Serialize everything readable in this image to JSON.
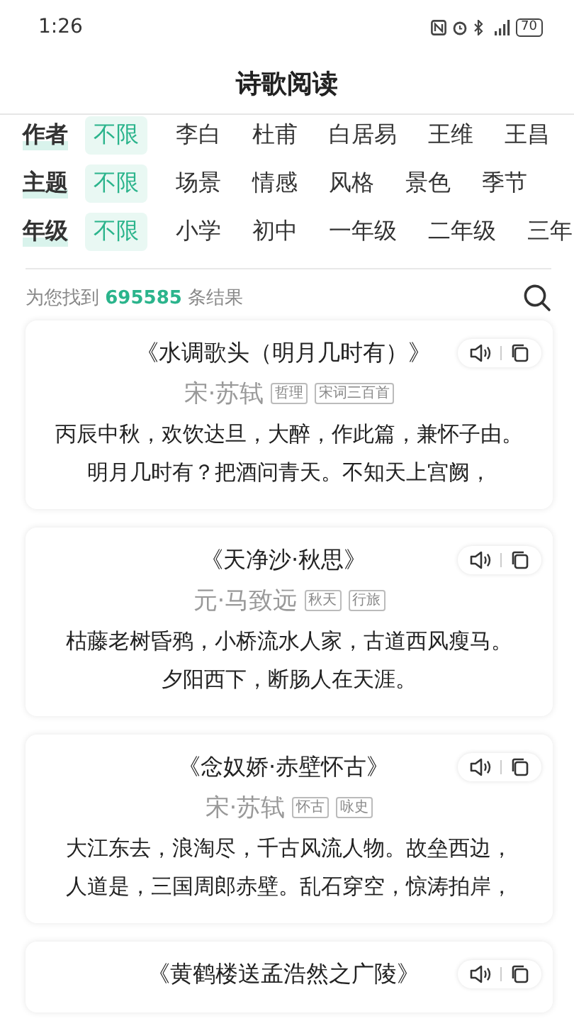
{
  "status_bar": {
    "time": "1:26",
    "battery": "70"
  },
  "header": {
    "title": "诗歌阅读"
  },
  "filters": [
    {
      "label": "作者",
      "options": [
        {
          "text": "不限",
          "selected": true
        },
        {
          "text": "李白",
          "selected": false
        },
        {
          "text": "杜甫",
          "selected": false
        },
        {
          "text": "白居易",
          "selected": false
        },
        {
          "text": "王维",
          "selected": false
        },
        {
          "text": "王昌",
          "selected": false
        }
      ]
    },
    {
      "label": "主题",
      "options": [
        {
          "text": "不限",
          "selected": true
        },
        {
          "text": "场景",
          "selected": false
        },
        {
          "text": "情感",
          "selected": false
        },
        {
          "text": "风格",
          "selected": false
        },
        {
          "text": "景色",
          "selected": false
        },
        {
          "text": "季节",
          "selected": false
        }
      ]
    },
    {
      "label": "年级",
      "options": [
        {
          "text": "不限",
          "selected": true
        },
        {
          "text": "小学",
          "selected": false
        },
        {
          "text": "初中",
          "selected": false
        },
        {
          "text": "一年级",
          "selected": false
        },
        {
          "text": "二年级",
          "selected": false
        },
        {
          "text": "三年",
          "selected": false
        }
      ]
    }
  ],
  "results": {
    "prefix": "为您找到",
    "count": "695585",
    "suffix": "条结果"
  },
  "poems": [
    {
      "title": "《水调歌头（明月几时有）》",
      "author": "宋·苏轼",
      "tags": [
        "哲理",
        "宋词三百首"
      ],
      "lines": [
        "丙辰中秋，欢饮达旦，大醉，作此篇，兼怀子由。",
        "明月几时有？把酒问青天。不知天上宫阙，"
      ]
    },
    {
      "title": "《天净沙·秋思》",
      "author": "元·马致远",
      "tags": [
        "秋天",
        "行旅"
      ],
      "lines": [
        "枯藤老树昏鸦，小桥流水人家，古道西风瘦马。",
        "夕阳西下，断肠人在天涯。"
      ]
    },
    {
      "title": "《念奴娇·赤壁怀古》",
      "author": "宋·苏轼",
      "tags": [
        "怀古",
        "咏史"
      ],
      "lines": [
        "大江东去，浪淘尽，千古风流人物。故垒西边，",
        "人道是，三国周郎赤壁。乱石穿空，惊涛拍岸，"
      ]
    },
    {
      "title": "《黄鹤楼送孟浩然之广陵》"
    }
  ]
}
